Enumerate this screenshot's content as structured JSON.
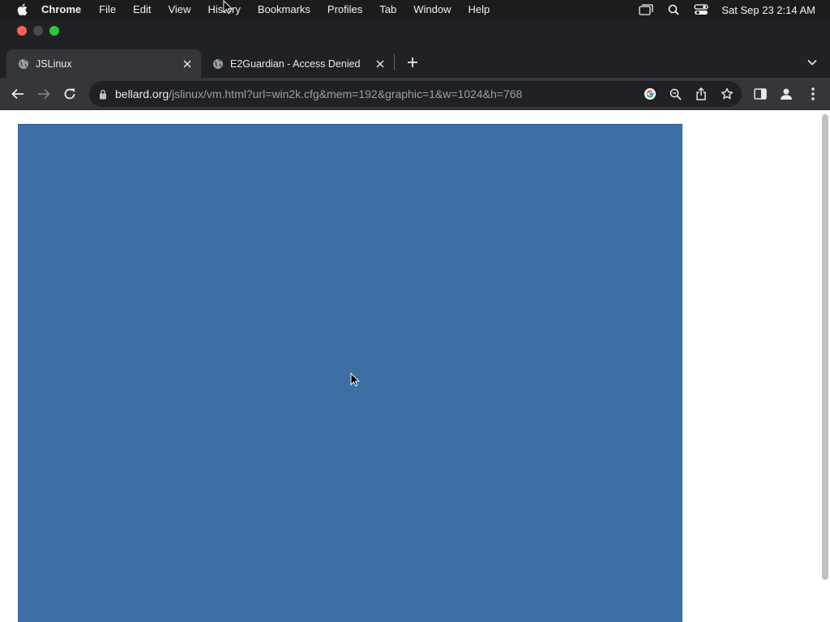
{
  "menubar": {
    "app_name": "Chrome",
    "items": [
      "File",
      "Edit",
      "View",
      "History",
      "Bookmarks",
      "Profiles",
      "Tab",
      "Window",
      "Help"
    ],
    "clock": "Sat Sep 23  2:14 AM",
    "tray_icons": [
      "screen-mirroring-icon",
      "spotlight-search-icon",
      "control-center-icon"
    ]
  },
  "tabs": [
    {
      "title": "JSLinux",
      "active": true,
      "favicon": "globe-icon"
    },
    {
      "title": "E2Guardian - Access Denied",
      "active": false,
      "favicon": "globe-icon"
    }
  ],
  "toolbar": {
    "url_host": "bellard.org",
    "url_path": "/jslinux/vm.html?url=win2k.cfg&mem=192&graphic=1&w=1024&h=768"
  },
  "page": {
    "vm_screen_color": "#3d6fa5"
  },
  "colors": {
    "menubar_bg": "#1c1c1e",
    "tabstrip_bg": "#202124",
    "active_tab_bg": "#35363a",
    "omnibox_bg": "#202124"
  }
}
